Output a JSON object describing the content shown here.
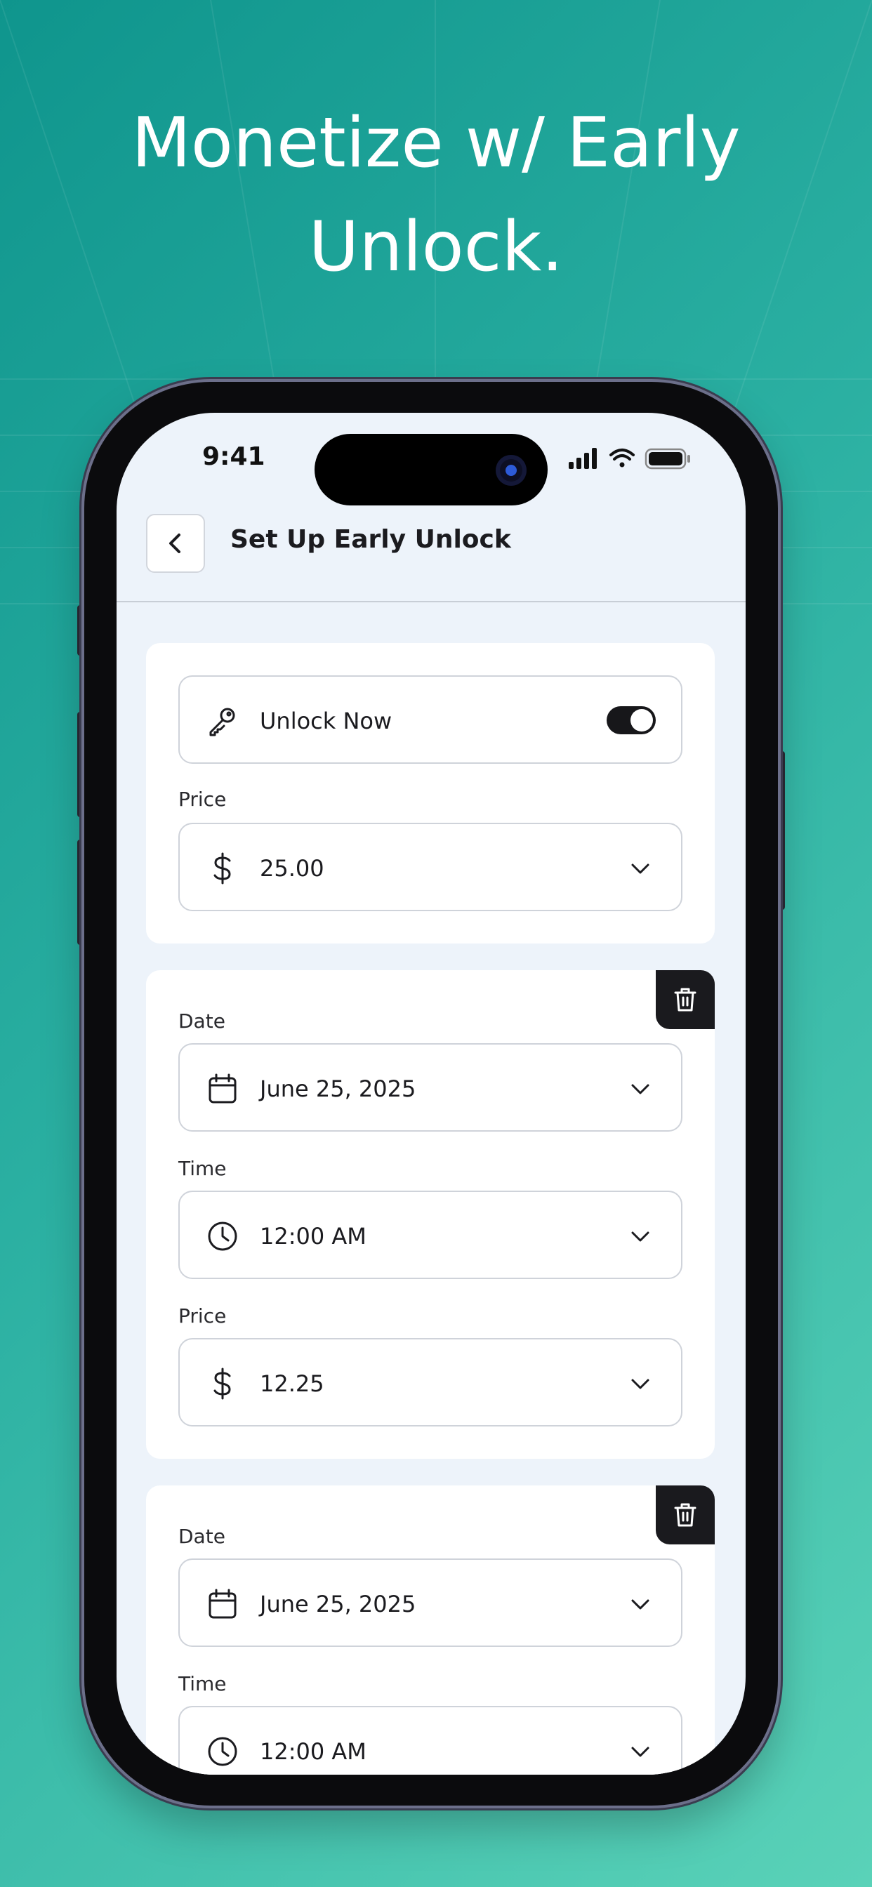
{
  "headline": {
    "line1": "Monetize w/ Early",
    "line2": "Unlock."
  },
  "status_bar": {
    "time": "9:41"
  },
  "header": {
    "title": "Set Up Early Unlock"
  },
  "unlock_section": {
    "toggle_label": "Unlock Now",
    "toggle_on": true,
    "price_label": "Price",
    "price_value": "25.00"
  },
  "schedules": [
    {
      "date_label": "Date",
      "date_value": "June 25, 2025",
      "time_label": "Time",
      "time_value": "12:00 AM",
      "price_label": "Price",
      "price_value": "12.25"
    },
    {
      "date_label": "Date",
      "date_value": "June 25, 2025",
      "time_label": "Time",
      "time_value": "12:00 AM"
    }
  ],
  "icons": {
    "back": "chevron-left-icon",
    "key": "key-icon",
    "dollar": "dollar-icon",
    "calendar": "calendar-icon",
    "clock": "clock-icon",
    "trash": "trash-icon",
    "dropdown": "chevron-down-icon"
  },
  "colors": {
    "background_start": "#0f958d",
    "background_end": "#5ad2b8",
    "screen_bg": "#edf3fa",
    "card_bg": "#ffffff",
    "dark_accent": "#1a1a1e"
  }
}
